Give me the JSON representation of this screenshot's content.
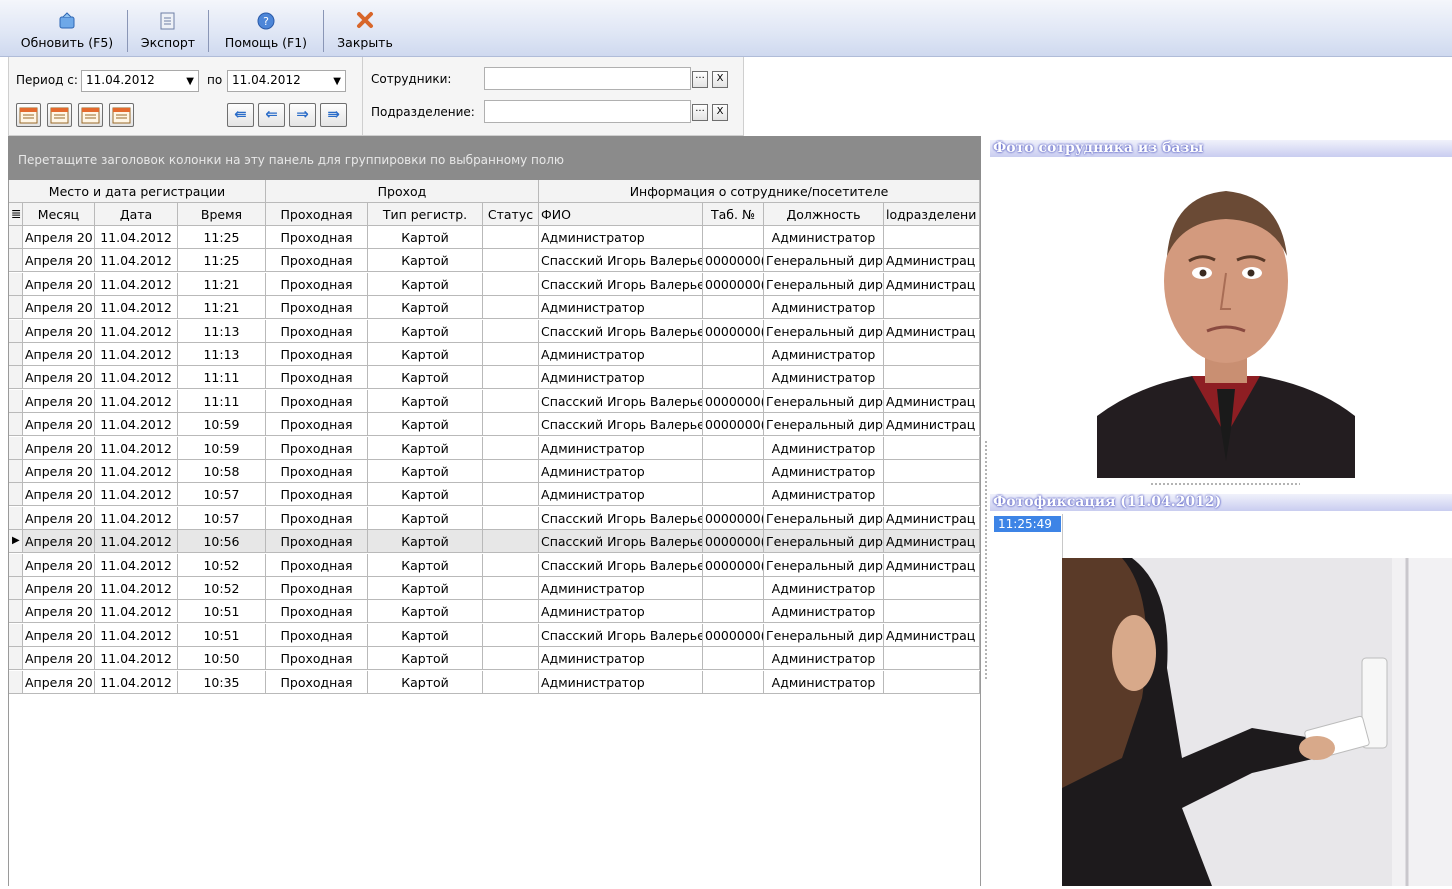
{
  "toolbar": {
    "refresh_label": "Обновить (F5)",
    "export_label": "Экспорт",
    "help_label": "Помощь (F1)",
    "close_label": "Закрыть"
  },
  "filter": {
    "period_from_label": "Период с:",
    "period_from_value": "11.04.2012",
    "period_to_label": "по",
    "period_to_value": "11.04.2012",
    "employees_label": "Сотрудники:",
    "employees_value": "",
    "department_label": "Подразделение:",
    "department_value": "",
    "browse_label": "···",
    "clear_label": "X"
  },
  "grid": {
    "group_panel_text": "Перетащите заголовок колонки на эту панель для группировки по выбранному полю",
    "bands": [
      "Место и дата регистрации",
      "Проход",
      "Информация о сотруднике/посетителе"
    ],
    "columns": [
      "Месяц",
      "Дата",
      "Время",
      "Проходная",
      "Тип регистр.",
      "Статус",
      "ФИО",
      "Таб. №",
      "Должность",
      "lодразделени"
    ],
    "rows": [
      [
        "Апреля 20",
        "11.04.2012",
        "11:25",
        "Проходная",
        "Картой",
        "",
        "Администратор",
        "",
        "Администратор",
        ""
      ],
      [
        "Апреля 20",
        "11.04.2012",
        "11:25",
        "Проходная",
        "Картой",
        "",
        "Спасский Игорь Валерьев",
        "0000000(",
        "Генеральный дире",
        "Администрац"
      ],
      [
        "Апреля 20",
        "11.04.2012",
        "11:21",
        "Проходная",
        "Картой",
        "",
        "Спасский Игорь Валерьев",
        "0000000(",
        "Генеральный дире",
        "Администрац"
      ],
      [
        "Апреля 20",
        "11.04.2012",
        "11:21",
        "Проходная",
        "Картой",
        "",
        "Администратор",
        "",
        "Администратор",
        ""
      ],
      [
        "Апреля 20",
        "11.04.2012",
        "11:13",
        "Проходная",
        "Картой",
        "",
        "Спасский Игорь Валерьев",
        "0000000(",
        "Генеральный дире",
        "Администрац"
      ],
      [
        "Апреля 20",
        "11.04.2012",
        "11:13",
        "Проходная",
        "Картой",
        "",
        "Администратор",
        "",
        "Администратор",
        ""
      ],
      [
        "Апреля 20",
        "11.04.2012",
        "11:11",
        "Проходная",
        "Картой",
        "",
        "Администратор",
        "",
        "Администратор",
        ""
      ],
      [
        "Апреля 20",
        "11.04.2012",
        "11:11",
        "Проходная",
        "Картой",
        "",
        "Спасский Игорь Валерьев",
        "0000000(",
        "Генеральный дире",
        "Администрац"
      ],
      [
        "Апреля 20",
        "11.04.2012",
        "10:59",
        "Проходная",
        "Картой",
        "",
        "Спасский Игорь Валерьев",
        "0000000(",
        "Генеральный дире",
        "Администрац"
      ],
      [
        "Апреля 20",
        "11.04.2012",
        "10:59",
        "Проходная",
        "Картой",
        "",
        "Администратор",
        "",
        "Администратор",
        ""
      ],
      [
        "Апреля 20",
        "11.04.2012",
        "10:58",
        "Проходная",
        "Картой",
        "",
        "Администратор",
        "",
        "Администратор",
        ""
      ],
      [
        "Апреля 20",
        "11.04.2012",
        "10:57",
        "Проходная",
        "Картой",
        "",
        "Администратор",
        "",
        "Администратор",
        ""
      ],
      [
        "Апреля 20",
        "11.04.2012",
        "10:57",
        "Проходная",
        "Картой",
        "",
        "Спасский Игорь Валерьев",
        "0000000(",
        "Генеральный дире",
        "Администрац"
      ],
      [
        "Апреля 20",
        "11.04.2012",
        "10:56",
        "Проходная",
        "Картой",
        "",
        "Спасский Игорь Валерьев",
        "0000000(",
        "Генеральный дире",
        "Администрац"
      ],
      [
        "Апреля 20",
        "11.04.2012",
        "10:52",
        "Проходная",
        "Картой",
        "",
        "Спасский Игорь Валерьев",
        "0000000(",
        "Генеральный дире",
        "Администрац"
      ],
      [
        "Апреля 20",
        "11.04.2012",
        "10:52",
        "Проходная",
        "Картой",
        "",
        "Администратор",
        "",
        "Администратор",
        ""
      ],
      [
        "Апреля 20",
        "11.04.2012",
        "10:51",
        "Проходная",
        "Картой",
        "",
        "Администратор",
        "",
        "Администратор",
        ""
      ],
      [
        "Апреля 20",
        "11.04.2012",
        "10:51",
        "Проходная",
        "Картой",
        "",
        "Спасский Игорь Валерьев",
        "0000000(",
        "Генеральный дире",
        "Администрац"
      ],
      [
        "Апреля 20",
        "11.04.2012",
        "10:50",
        "Проходная",
        "Картой",
        "",
        "Администратор",
        "",
        "Администратор",
        ""
      ],
      [
        "Апреля 20",
        "11.04.2012",
        "10:35",
        "Проходная",
        "Картой",
        "",
        "Администратор",
        "",
        "Администратор",
        ""
      ]
    ],
    "selected_row": 13
  },
  "photo_panel": {
    "title": "Фото сотрудника из базы"
  },
  "fixation_panel": {
    "title": "Фотофиксация (11.04.2012)",
    "times": [
      "11:25:49"
    ]
  },
  "colors": {
    "selection_blue": "#3d84e6",
    "group_panel_gray": "#8b8b8b",
    "title_text_blue": "#5c63c6"
  }
}
